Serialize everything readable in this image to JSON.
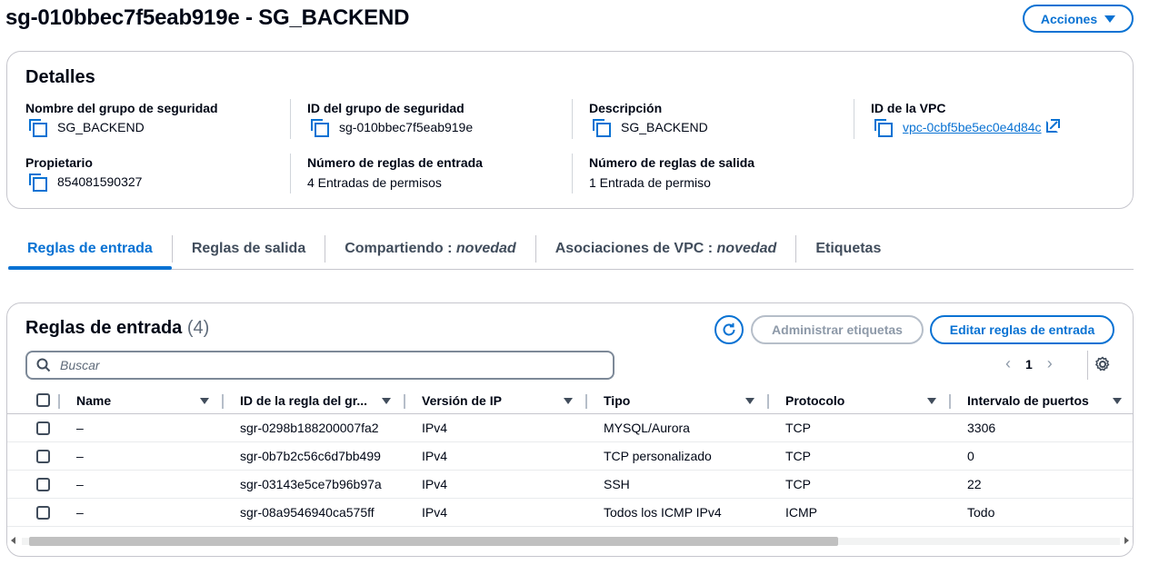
{
  "header": {
    "title": "sg-010bbec7f5eab919e - SG_BACKEND",
    "actions_label": "Acciones"
  },
  "details": {
    "title": "Detalles",
    "fields": [
      {
        "label": "Nombre del grupo de seguridad",
        "value": "SG_BACKEND",
        "copyable": true
      },
      {
        "label": "ID del grupo de seguridad",
        "value": "sg-010bbec7f5eab919e",
        "copyable": true
      },
      {
        "label": "Descripción",
        "value": "SG_BACKEND",
        "copyable": true
      },
      {
        "label": "ID de la VPC",
        "value": "vpc-0cbf5be5ec0e4d84c",
        "copyable": true,
        "link": true
      },
      {
        "label": "Propietario",
        "value": "854081590327",
        "copyable": true
      },
      {
        "label": "Número de reglas de entrada",
        "value": "4 Entradas de permisos",
        "copyable": false
      },
      {
        "label": "Número de reglas de salida",
        "value": "1 Entrada de permiso",
        "copyable": false
      }
    ]
  },
  "tabs": [
    {
      "label": "Reglas de entrada",
      "suffix": "",
      "active": true
    },
    {
      "label": "Reglas de salida",
      "suffix": "",
      "active": false
    },
    {
      "label": "Compartiendo : ",
      "suffix": "novedad",
      "active": false
    },
    {
      "label": "Asociaciones de VPC : ",
      "suffix": "novedad",
      "active": false
    },
    {
      "label": "Etiquetas",
      "suffix": "",
      "active": false
    }
  ],
  "rules": {
    "title": "Reglas de entrada",
    "count": "(4)",
    "manage_tags_label": "Administrar etiquetas",
    "edit_rules_label": "Editar reglas de entrada",
    "search_placeholder": "Buscar",
    "page": "1",
    "columns": [
      "Name",
      "ID de la regla del gr...",
      "Versión de IP",
      "Tipo",
      "Protocolo",
      "Intervalo de puertos"
    ],
    "rows": [
      {
        "name": "–",
        "id": "sgr-0298b188200007fa2",
        "ip_version": "IPv4",
        "type": "MYSQL/Aurora",
        "protocol": "TCP",
        "ports": "3306"
      },
      {
        "name": "–",
        "id": "sgr-0b7b2c56c6d7bb499",
        "ip_version": "IPv4",
        "type": "TCP personalizado",
        "protocol": "TCP",
        "ports": "0"
      },
      {
        "name": "–",
        "id": "sgr-03143e5ce7b96b97a",
        "ip_version": "IPv4",
        "type": "SSH",
        "protocol": "TCP",
        "ports": "22"
      },
      {
        "name": "–",
        "id": "sgr-08a9546940ca575ff",
        "ip_version": "IPv4",
        "type": "Todos los ICMP IPv4",
        "protocol": "ICMP",
        "ports": "Todo"
      }
    ]
  },
  "icons": {
    "copy": "copy-icon",
    "external": "external-link-icon",
    "refresh": "refresh-icon",
    "search": "search-icon",
    "settings": "gear-icon"
  },
  "colors": {
    "accent": "#0972d3",
    "disabled": "#8d99a8",
    "border": "#c6c6cd"
  }
}
